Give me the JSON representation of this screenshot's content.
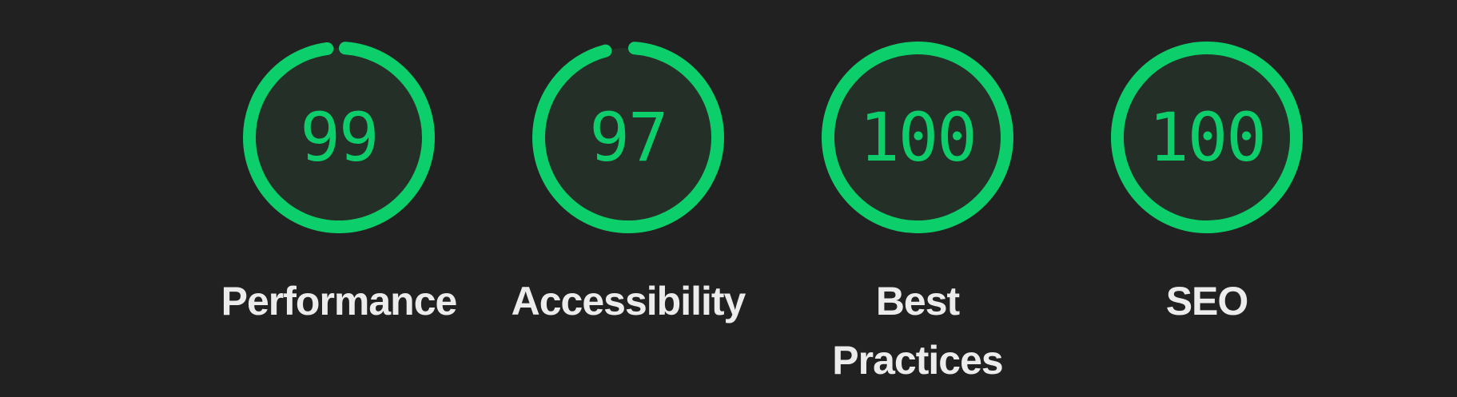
{
  "colors": {
    "background": "#212121",
    "pass": "#0cce6b",
    "gauge_fill": "#242f27",
    "label": "#ececec"
  },
  "gauges": [
    {
      "label": "Performance",
      "score": "99",
      "fraction": 0.99
    },
    {
      "label": "Accessibility",
      "score": "97",
      "fraction": 0.97
    },
    {
      "label": "Best Practices",
      "score": "100",
      "fraction": 1.0
    },
    {
      "label": "SEO",
      "score": "100",
      "fraction": 1.0
    }
  ]
}
